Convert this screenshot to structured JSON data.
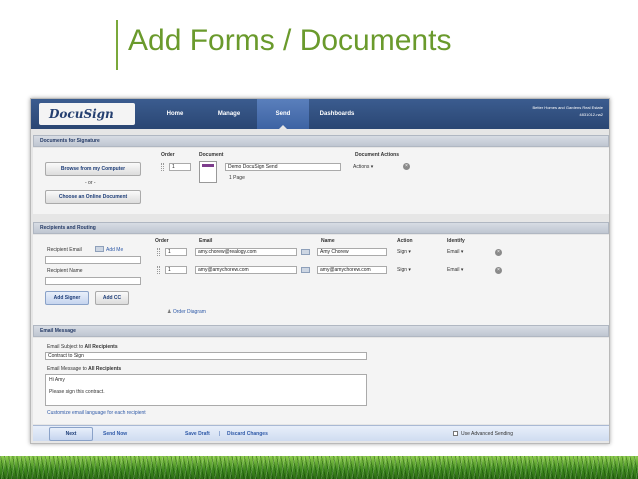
{
  "slide": {
    "title": "Add Forms / Documents"
  },
  "app": {
    "logo": "DocuSign",
    "nav": [
      "Home",
      "Manage",
      "Send",
      "Dashboards"
    ],
    "account_name": "Better Homes and Gardens Real Estate",
    "account_id": "4831012-na2"
  },
  "documents": {
    "header": "Documents for Signature",
    "browse_button": "Browse from my Computer",
    "or": "- or -",
    "online_button": "Choose an Online Document",
    "col_order": "Order",
    "col_document": "Document",
    "col_actions": "Document Actions",
    "order": "1",
    "doc_name": "Demo DocuSign Send",
    "doc_pages": "1 Page",
    "actions": "Actions ▾"
  },
  "recipients": {
    "header": "Recipients and Routing",
    "email_label": "Recipient Email",
    "add_me": "Add Me",
    "name_label": "Recipient Name",
    "add_signer": "Add Signer",
    "add_cc": "Add CC",
    "col_order": "Order",
    "col_email": "Email",
    "col_name": "Name",
    "col_action": "Action",
    "col_identify": "Identify",
    "rows": [
      {
        "order": "1",
        "email": "amy.chorew@realogy.com",
        "name": "Amy Chorew",
        "action": "Sign ▾",
        "identify": "Email ▾"
      },
      {
        "order": "1",
        "email": "amy@amychorew.com",
        "name": "amy@amychorew.com",
        "action": "Sign ▾",
        "identify": "Email ▾"
      }
    ],
    "order_diagram": "Order Diagram"
  },
  "email": {
    "header": "Email Message",
    "subject_prefix": "Email Subject to",
    "subject_target": "All Recipients",
    "subject_value": "Contract to Sign",
    "message_prefix": "Email Message to",
    "message_target": "All Recipients",
    "message_line1": "Hi Amy",
    "message_line2": "Please sign this contract.",
    "customize_link": "Customize email language for each recipient"
  },
  "footer": {
    "next": "Next",
    "send_now": "Send Now",
    "save_draft": "Save Draft",
    "separator": "|",
    "discard": "Discard Changes",
    "advanced": "Use Advanced Sending"
  }
}
